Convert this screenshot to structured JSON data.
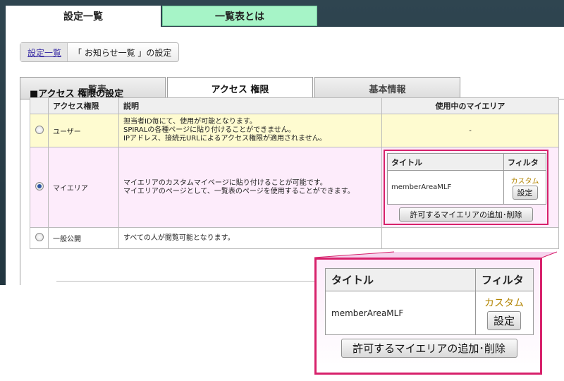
{
  "top_tabs": [
    {
      "label": "設定一覧",
      "active": true
    },
    {
      "label": "一覧表とは",
      "active": false
    }
  ],
  "breadcrumb": {
    "link": "設定一覧",
    "current": "「 お知らせ一覧 」の設定"
  },
  "sub_tabs": [
    {
      "label": "一覧表",
      "active": false
    },
    {
      "label": "アクセス 権限",
      "active": true
    },
    {
      "label": "基本情報",
      "active": false
    }
  ],
  "section_title": "■アクセス 権限の設定",
  "table": {
    "headers": [
      "",
      "アクセス権限",
      "説明",
      "使用中のマイエリア"
    ],
    "rows": [
      {
        "selected": false,
        "name": "ユーザー",
        "description": [
          "担当者ID毎にて、使用が可能となります。",
          "SPIRALの各種ページに貼り付けることができません。",
          "IPアドレス、接続元URLによるアクセス権限が適用されません。"
        ],
        "myarea": "-"
      },
      {
        "selected": true,
        "name": "マイエリア",
        "description": [
          "マイエリアのカスタムマイページに貼り付けることが可能です。",
          "マイエリアのページとして、一覧表のページを使用することができます。"
        ]
      },
      {
        "selected": false,
        "name": "一般公開",
        "description": [
          "すべての人が閲覧可能となります。"
        ]
      }
    ]
  },
  "myarea_table": {
    "headers": [
      "タイトル",
      "フィルタ"
    ],
    "title_value": "memberAreaMLF",
    "filter_value": "カスタム",
    "settings_button": "設定",
    "add_button": "許可するマイエリアの追加･削除"
  },
  "colors": {
    "accent_pink": "#d7216b",
    "user_row_bg": "#fefbd0",
    "myarea_row_bg": "#fdecfb",
    "filter_text": "#b28400",
    "second_tab_bg": "#a6f4c7"
  }
}
